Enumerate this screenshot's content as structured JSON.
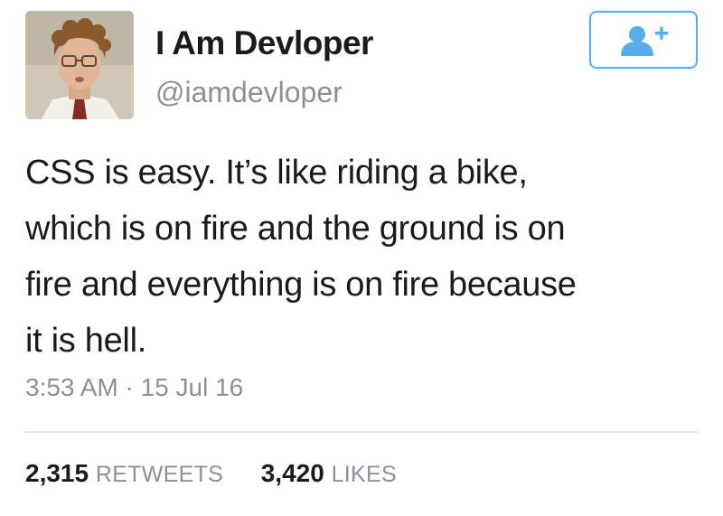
{
  "user": {
    "display_name": "I Am Devloper",
    "handle": "@iamdevloper",
    "avatar_icon": "profile-photo"
  },
  "follow_button": {
    "icon": "add-user-icon",
    "accent_color": "#55acee"
  },
  "tweet": {
    "lines": [
      "CSS is easy. It’s like riding a bike,",
      "which is on fire and the ground is on",
      "fire and everything is on fire because",
      "it is hell."
    ],
    "timestamp": "3:53 AM · 15 Jul 16"
  },
  "stats": {
    "retweets_count": "2,315",
    "retweets_label": "RETWEETS",
    "likes_count": "3,420",
    "likes_label": "LIKES"
  }
}
